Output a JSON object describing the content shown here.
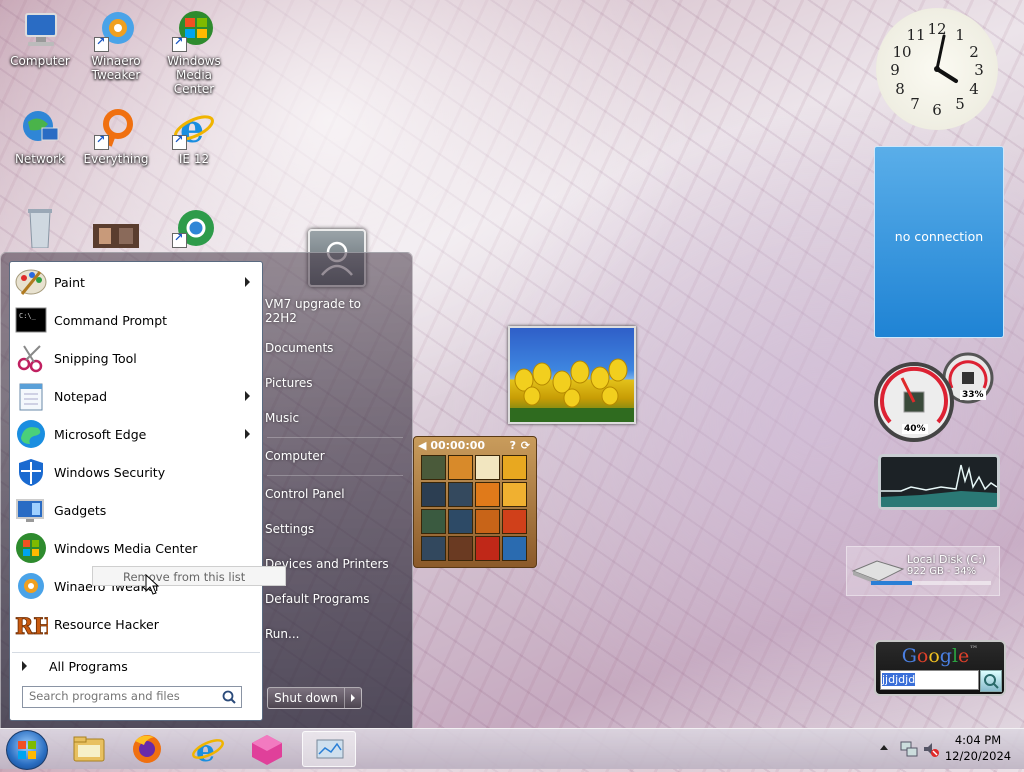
{
  "desktop": {
    "icons": [
      {
        "label": "Computer"
      },
      {
        "label": "Winaero Tweaker"
      },
      {
        "label": "Windows Media Center"
      },
      {
        "label": "Network"
      },
      {
        "label": "Everything"
      },
      {
        "label": "IE 12"
      }
    ]
  },
  "start_menu": {
    "pinned": [
      {
        "label": "Paint",
        "has_submenu": true
      },
      {
        "label": "Command Prompt",
        "has_submenu": false
      },
      {
        "label": "Snipping Tool",
        "has_submenu": false
      },
      {
        "label": "Notepad",
        "has_submenu": true
      },
      {
        "label": "Microsoft Edge",
        "has_submenu": true
      },
      {
        "label": "Windows Security",
        "has_submenu": false
      },
      {
        "label": "Gadgets",
        "has_submenu": false
      },
      {
        "label": "Windows Media Center",
        "has_submenu": false
      },
      {
        "label": "Winaero Tweaker",
        "has_submenu": false
      },
      {
        "label": "Resource Hacker",
        "has_submenu": false
      }
    ],
    "all_programs": "All Programs",
    "search_placeholder": "Search programs and files",
    "right_links": [
      "VM7 upgrade to 22H2",
      "Documents",
      "Pictures",
      "Music",
      "Computer",
      "Control Panel",
      "Settings",
      "Devices and Printers",
      "Default Programs",
      "Run..."
    ],
    "shutdown_label": "Shut down",
    "context_tooltip": "Remove from this list"
  },
  "gadgets": {
    "weather_text": "no connection",
    "puzzle_timer": "00:00:00",
    "cpu_meter": {
      "cpu_percent": "40%",
      "ram_percent": "33%",
      "cpu_value": 0.4,
      "ram_value": 0.33
    },
    "drive": {
      "name": "Local Disk (C:)",
      "detail": "922 GB - 34%",
      "used_fraction": 0.34
    },
    "google": {
      "logo": "Google",
      "query": "jjdjdjd"
    }
  },
  "taskbar": {
    "time": "4:04 PM",
    "date": "12/20/2024"
  },
  "colors": {
    "weather_bg": "#1f83d4",
    "drive_bar": "#2a7fd6",
    "selection": "#3a6fd8"
  }
}
